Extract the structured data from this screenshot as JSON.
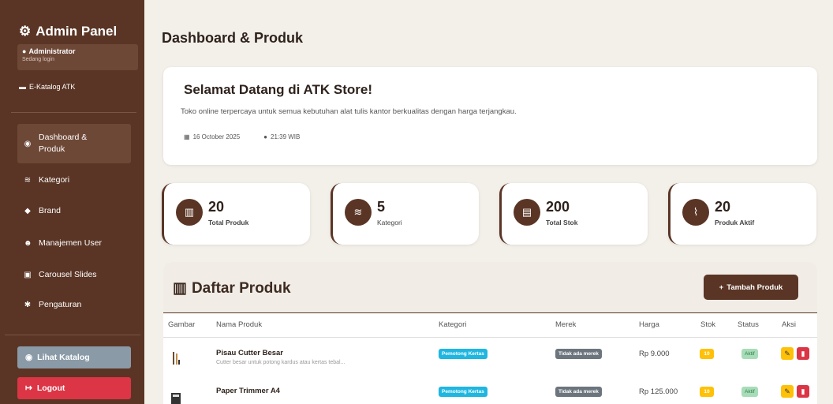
{
  "sidebar": {
    "brand": "Admin Panel",
    "user_name": "Administrator",
    "user_status": "Sedang login",
    "ekatalog": "E-Katalog ATK",
    "items": [
      {
        "label": "Dashboard &",
        "label2": "Produk",
        "icon": "dashboard-icon"
      },
      {
        "label": "Kategori",
        "icon": "layers-icon"
      },
      {
        "label": "Brand",
        "icon": "tag-icon"
      },
      {
        "label": "Manajemen User",
        "icon": "users-icon"
      },
      {
        "label": "Carousel Slides",
        "icon": "images-icon"
      },
      {
        "label": "Pengaturan",
        "icon": "gear-icon"
      }
    ],
    "katalog_button": "Lihat Katalog",
    "logout_button": "Logout"
  },
  "main": {
    "page_title": "Dashboard & Produk",
    "welcome": {
      "title": "Selamat Datang di ATK Store!",
      "subtitle": "Toko online terpercaya untuk semua kebutuhan alat tulis kantor berkualitas dengan harga terjangkau.",
      "date": "16 October 2025",
      "time": "21:39 WIB"
    },
    "stats": [
      {
        "value": "20",
        "label": "Total Produk",
        "icon": "box-icon"
      },
      {
        "value": "5",
        "label": "Kategori",
        "icon": "layers-icon"
      },
      {
        "value": "200",
        "label": "Total Stok",
        "icon": "warehouse-icon"
      },
      {
        "value": "20",
        "label": "Produk Aktif",
        "icon": "chart-line-icon"
      }
    ],
    "list": {
      "title": "Daftar Produk",
      "add_button": "Tambah Produk",
      "columns": [
        "Gambar",
        "Nama Produk",
        "Kategori",
        "Merek",
        "Harga",
        "Stok",
        "Status",
        "Aksi"
      ],
      "rows": [
        {
          "name": "Pisau Cutter Besar",
          "desc": "Cutter besar untuk potong kardus atau kertas tebal...",
          "kategori": "Pemotong Kertas",
          "merek": "Tidak ada merek",
          "harga": "Rp 9.000",
          "stok": "10",
          "status": "Aktif"
        },
        {
          "name": "Paper Trimmer A4",
          "desc": "",
          "kategori": "Pemotong Kertas",
          "merek": "Tidak ada merek",
          "harga": "Rp 125.000",
          "stok": "10",
          "status": "Aktif"
        }
      ]
    }
  },
  "colors": {
    "primary": "#5a3525",
    "accent_blue": "#1fb6e0",
    "danger": "#dc3545",
    "warning": "#ffc107"
  }
}
